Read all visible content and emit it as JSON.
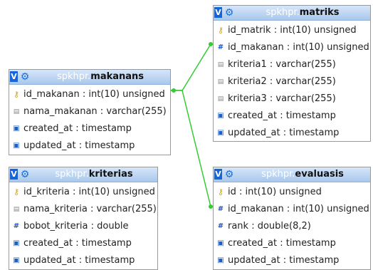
{
  "tables": {
    "matriks": {
      "db": "spkhpr.",
      "name": "matriks",
      "columns": [
        {
          "icon": "key",
          "text": "id_matrik : int(10) unsigned"
        },
        {
          "icon": "hash",
          "text": "id_makanan : int(10) unsigned"
        },
        {
          "icon": "txt",
          "text": "kriteria1 : varchar(255)"
        },
        {
          "icon": "txt",
          "text": "kriteria2 : varchar(255)"
        },
        {
          "icon": "txt",
          "text": "kriteria3 : varchar(255)"
        },
        {
          "icon": "date",
          "text": "created_at : timestamp"
        },
        {
          "icon": "date",
          "text": "updated_at : timestamp"
        }
      ]
    },
    "makanans": {
      "db": "spkhpr.",
      "name": "makanans",
      "columns": [
        {
          "icon": "key",
          "text": "id_makanan : int(10) unsigned"
        },
        {
          "icon": "txt",
          "text": "nama_makanan : varchar(255)"
        },
        {
          "icon": "date",
          "text": "created_at : timestamp"
        },
        {
          "icon": "date",
          "text": "updated_at : timestamp"
        }
      ]
    },
    "kriterias": {
      "db": "spkhpr.",
      "name": "kriterias",
      "columns": [
        {
          "icon": "key",
          "text": "id_kriteria : int(10) unsigned"
        },
        {
          "icon": "txt",
          "text": "nama_kriteria : varchar(255)"
        },
        {
          "icon": "hash",
          "text": "bobot_kriteria : double"
        },
        {
          "icon": "date",
          "text": "created_at : timestamp"
        },
        {
          "icon": "date",
          "text": "updated_at : timestamp"
        }
      ]
    },
    "evaluasis": {
      "db": "spkhpr.",
      "name": "evaluasis",
      "columns": [
        {
          "icon": "key",
          "text": "id : int(10) unsigned"
        },
        {
          "icon": "hash",
          "text": "id_makanan : int(10) unsigned"
        },
        {
          "icon": "hash",
          "text": "rank : double(8,2)"
        },
        {
          "icon": "date",
          "text": "created_at : timestamp"
        },
        {
          "icon": "date",
          "text": "updated_at : timestamp"
        }
      ]
    }
  },
  "header_badge": "V",
  "colors": {
    "relation_line": "#33cc33",
    "header_gradient_top": "#d6e6f9",
    "header_gradient_bottom": "#a9c8ec",
    "badge": "#1565d8"
  }
}
